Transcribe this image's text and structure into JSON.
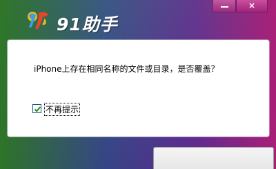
{
  "window": {
    "app_title": "91助手",
    "logo_icon": "91-logo-icon",
    "minimize_icon": "minimize-icon",
    "close_icon": "close-icon",
    "close_glyph": "×"
  },
  "dialog": {
    "message": "iPhone上存在相同名称的文件或目录，是否覆盖？",
    "checkbox": {
      "label": "不再提示",
      "checked": true
    },
    "button": {
      "label": ""
    }
  },
  "colors": {
    "gradient_left": "#2e7824",
    "gradient_right": "#af1e78",
    "content_bg": "#ffffff"
  }
}
